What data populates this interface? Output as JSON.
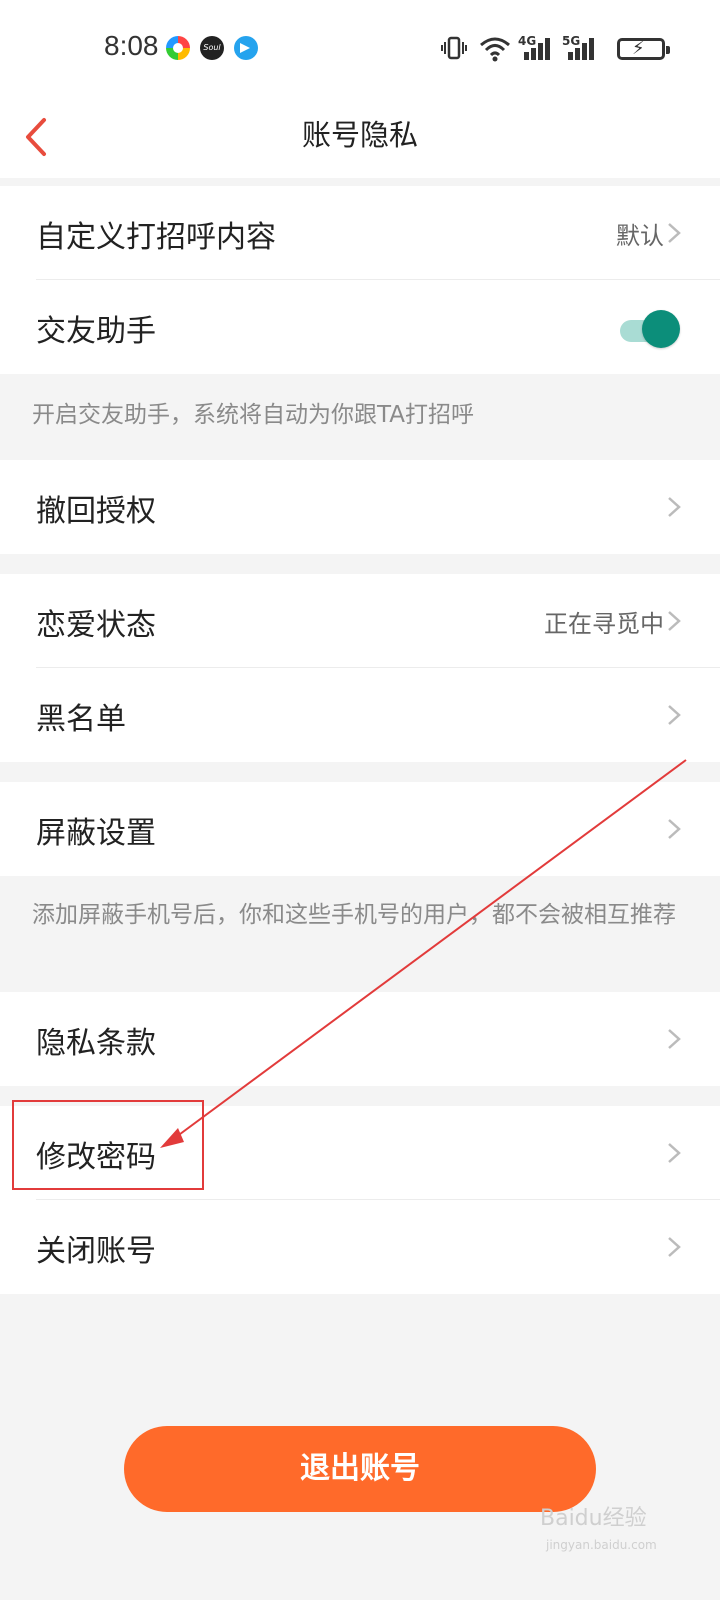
{
  "status_bar": {
    "time": "8:08",
    "app_icons": [
      "colorful-circle-app-icon",
      "soul-app-icon",
      "blue-app-icon"
    ],
    "soul_label": "Soul",
    "net_4g": "4G",
    "net_5g": "5G"
  },
  "header": {
    "title": "账号隐私",
    "accent_color": "#e84c3d"
  },
  "settings": {
    "greeting": {
      "label": "自定义打招呼内容",
      "value": "默认"
    },
    "helper": {
      "label": "交友助手",
      "enabled": true
    },
    "helper_note": "开启交友助手，系统将自动为你跟TA打招呼",
    "revoke": {
      "label": "撤回授权"
    },
    "relationship": {
      "label": "恋爱状态",
      "value": "正在寻觅中"
    },
    "blacklist": {
      "label": "黑名单"
    },
    "block": {
      "label": "屏蔽设置"
    },
    "block_note": "添加屏蔽手机号后，你和这些手机号的用户，都不会被相互推荐",
    "privacy": {
      "label": "隐私条款"
    },
    "password": {
      "label": "修改密码"
    },
    "close_account": {
      "label": "关闭账号"
    }
  },
  "logout_button": {
    "label": "退出账号",
    "color": "#ff6a2a"
  },
  "toggle_color": "#0c8e7a",
  "watermark": {
    "text": "Baidu经验",
    "url": "jingyan.baidu.com"
  }
}
